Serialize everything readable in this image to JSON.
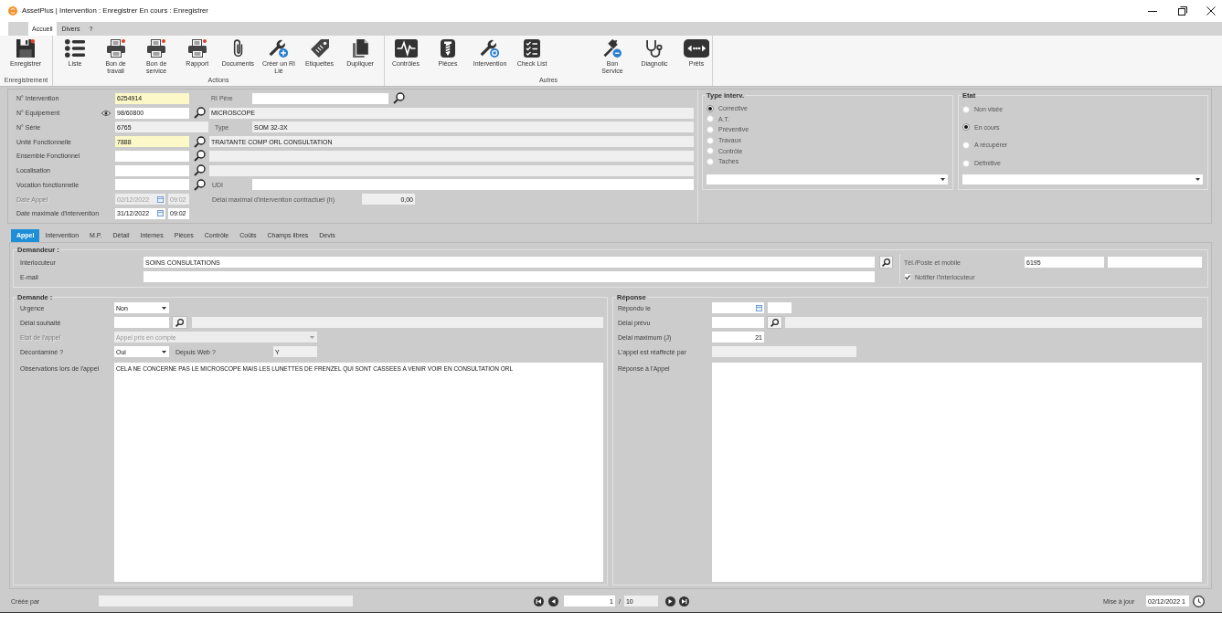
{
  "window": {
    "title": "AssetPlus | Intervention : Enregistrer En cours : Enregistrer"
  },
  "ribbon": {
    "tabs": [
      {
        "label": "Accueil",
        "selected": true
      },
      {
        "label": "Divers",
        "selected": false
      },
      {
        "label": "?",
        "selected": false
      }
    ],
    "groups": [
      {
        "label": "Enregistrement",
        "buttons": [
          {
            "label": "Enregistrer"
          }
        ]
      },
      {
        "label": "Actions",
        "buttons": [
          {
            "label": "Liste"
          },
          {
            "label": "Bon de\ntravail"
          },
          {
            "label": "Bon de\nservice"
          },
          {
            "label": "Rapport"
          },
          {
            "label": "Documents"
          },
          {
            "label": "Créer un RI\nLié"
          },
          {
            "label": "Etiquettes"
          },
          {
            "label": "Dupliquer"
          }
        ]
      },
      {
        "label": "Autres",
        "buttons": [
          {
            "label": "Contrôles"
          },
          {
            "label": "Pièces"
          },
          {
            "label": "Intervention"
          },
          {
            "label": "Check List"
          },
          {
            "label": "Bon\nService"
          },
          {
            "label": "Diagnotic"
          },
          {
            "label": "Prêts"
          }
        ]
      }
    ]
  },
  "equipment_form": {
    "intervention_no": {
      "label": "N° Intervention",
      "value": "6254914",
      "highlighted": true
    },
    "parent_ri": {
      "label": "RI Père"
    },
    "equipment_no": {
      "label": "N° Equipement",
      "value": "98/60800",
      "highlighted": false,
      "description": "MICROSCOPE"
    },
    "serial_no": {
      "label": "N° Série",
      "value": "6765"
    },
    "type": {
      "label": "Type",
      "value": "SOM 32-3X"
    },
    "functional_unit": {
      "label": "Unité Fonctionnelle",
      "value": "7888",
      "highlighted": true,
      "description": "TRAITANTE COMP ORL CONSULTATION"
    },
    "functional_set": {
      "label": "Ensemble Fonctionnel",
      "highlighted": false
    },
    "location": {
      "label": "Localisation",
      "highlighted": false
    },
    "functional_vocation": {
      "label": "Vocation fonctionnelle",
      "highlighted": false
    },
    "udi": {
      "label": "UDI"
    },
    "call_date": {
      "label": "Date Appel",
      "date": "02/12/2022",
      "time": "09:02",
      "disabled": true
    },
    "max_delay": {
      "label": "Délai maximal d'intervention contractuel (h)",
      "value": "0,00"
    },
    "max_date": {
      "label": "Date maximale d'intervention",
      "date": "31/12/2022",
      "time": "09:02",
      "disabled": false
    }
  },
  "intervention_type": {
    "title": "Type interv.",
    "options": [
      {
        "label": "Corrective",
        "selected": true
      },
      {
        "label": "A.T.",
        "selected": false
      },
      {
        "label": "Préventive",
        "selected": false
      },
      {
        "label": "Travaux",
        "selected": false
      },
      {
        "label": "Contrôle",
        "selected": false
      },
      {
        "label": "Taches",
        "selected": false
      }
    ]
  },
  "state": {
    "title": "Etat",
    "options": [
      {
        "label": "Non visée",
        "selected": false
      },
      {
        "label": "En cours",
        "selected": true
      },
      {
        "label": "A récupérer",
        "selected": false
      },
      {
        "label": "Définitive",
        "selected": false
      }
    ]
  },
  "detail_tabs": [
    {
      "label": "Appel",
      "selected": true
    },
    {
      "label": "Intervention",
      "selected": false
    },
    {
      "label": "M.P.",
      "selected": false
    },
    {
      "label": "Détail",
      "selected": false
    },
    {
      "label": "Internes",
      "selected": false
    },
    {
      "label": "Pièces",
      "selected": false
    },
    {
      "label": "Contrôle",
      "selected": false
    },
    {
      "label": "Coûts",
      "selected": false
    },
    {
      "label": "Champs libres",
      "selected": false
    },
    {
      "label": "Devis",
      "selected": false
    }
  ],
  "requester": {
    "title": "Demandeur :",
    "contact": {
      "label": "Interlocuteur",
      "value": "SOINS CONSULTATIONS"
    },
    "email": {
      "label": "E-mail"
    },
    "phone": {
      "label": "Tél./Poste et mobile",
      "value": "6195"
    },
    "notify": {
      "label": "Notifier l'interlocuteur",
      "checked": true
    }
  },
  "request": {
    "title": "Demande :",
    "urgency": {
      "label": "Urgence",
      "value": "Non"
    },
    "desired_delay": {
      "label": "Délai souhaité"
    },
    "call_state": {
      "label": "Etat de l'appel",
      "value": "Appel pris en compte",
      "disabled": true
    },
    "decontaminated": {
      "label": "Décontaminé ?",
      "value": "Oui"
    },
    "from_web": {
      "label": "Depuis Web ?",
      "value": "Y"
    },
    "observations": {
      "label": "Observations lors de l'appel",
      "value": "CELA NE CONCERNE PAS LE MICROSCOPE MAIS LES LUNETTES DE FRENZEL QUI SONT CASSEES A VENIR VOIR EN CONSULTATION ORL"
    }
  },
  "response": {
    "title": "Réponse",
    "answered_on": {
      "label": "Répondu le"
    },
    "planned_delay": {
      "label": "Délai prévu"
    },
    "max_delay": {
      "label": "Delai maximum (J)",
      "value": "21"
    },
    "reassigned_by": {
      "label": "L'appel est réaffecté par"
    },
    "answer": {
      "label": "Réponse à l'Appel"
    }
  },
  "status_bar": {
    "created_by": {
      "label": "Créée par"
    },
    "pager": {
      "current": "1",
      "separator": "/",
      "total": "10"
    },
    "updated": {
      "label": "Mise à jour",
      "value": "02/12/2022 1"
    }
  }
}
